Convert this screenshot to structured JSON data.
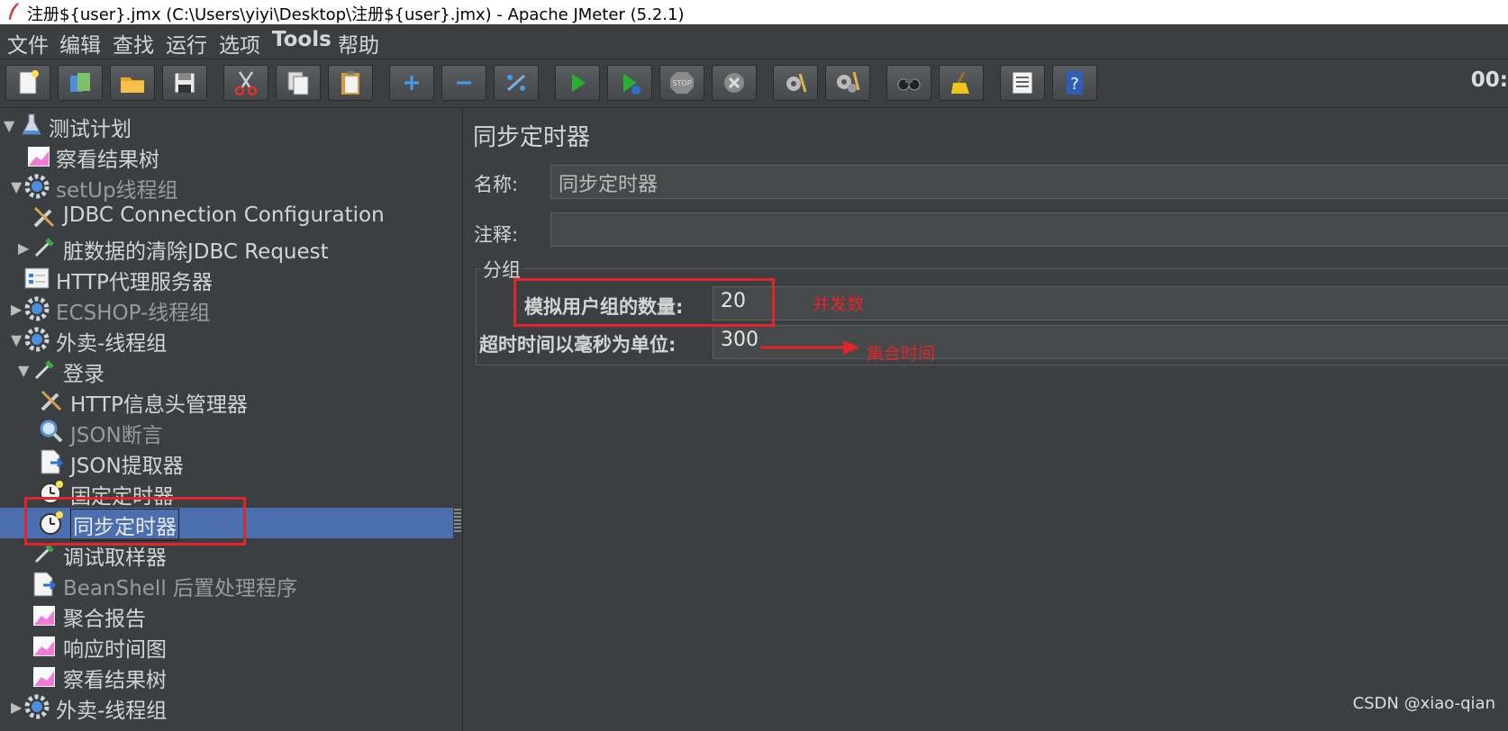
{
  "window": {
    "title": "注册${user}.jmx (C:\\Users\\yiyi\\Desktop\\注册${user}.jmx) - Apache JMeter (5.2.1)"
  },
  "menu": {
    "items": [
      "文件",
      "编辑",
      "查找",
      "运行",
      "选项",
      "Tools",
      "帮助"
    ]
  },
  "toolbar": {
    "buttons": [
      "new-icon",
      "templates-icon",
      "open-icon",
      "save-icon",
      "cut-icon",
      "copy-icon",
      "paste-icon",
      "expand-icon",
      "collapse-icon",
      "toggle-icon",
      "start-icon",
      "start-no-pause-icon",
      "stop-icon",
      "shutdown-icon",
      "clear-icon",
      "clear-all-icon",
      "search-icon",
      "reset-search-icon",
      "function-helper-icon",
      "help-icon"
    ],
    "timer": "00:"
  },
  "tree": {
    "items": [
      {
        "label": "测试计划",
        "icon": "flask-icon",
        "arrow": "▼"
      },
      {
        "label": "察看结果树",
        "icon": "graph-icon",
        "arrow": ""
      },
      {
        "label": "setUp线程组",
        "icon": "gear-icon",
        "arrow": "▼"
      },
      {
        "label": "JDBC Connection Configuration",
        "icon": "wrench-icon",
        "arrow": ""
      },
      {
        "label": "脏数据的清除JDBC Request",
        "icon": "dropper-icon",
        "arrow": "▶"
      },
      {
        "label": "HTTP代理服务器",
        "icon": "proxy-icon",
        "arrow": ""
      },
      {
        "label": "ECSHOP-线程组",
        "icon": "gear-icon",
        "arrow": "▶"
      },
      {
        "label": "外卖-线程组",
        "icon": "gear-icon",
        "arrow": "▼"
      },
      {
        "label": "登录",
        "icon": "dropper-icon",
        "arrow": "▼"
      },
      {
        "label": "HTTP信息头管理器",
        "icon": "wrench-icon",
        "arrow": ""
      },
      {
        "label": "JSON断言",
        "icon": "magnifier-icon",
        "arrow": ""
      },
      {
        "label": "JSON提取器",
        "icon": "document-icon",
        "arrow": ""
      },
      {
        "label": "固定定时器",
        "icon": "clock-icon",
        "arrow": ""
      },
      {
        "label": "同步定时器",
        "icon": "clock-icon",
        "arrow": ""
      },
      {
        "label": "调试取样器",
        "icon": "dropper-icon",
        "arrow": ""
      },
      {
        "label": "BeanShell 后置处理程序",
        "icon": "document-icon",
        "arrow": ""
      },
      {
        "label": "聚合报告",
        "icon": "graph-icon",
        "arrow": ""
      },
      {
        "label": "响应时间图",
        "icon": "graph-icon",
        "arrow": ""
      },
      {
        "label": "察看结果树",
        "icon": "graph-icon",
        "arrow": ""
      },
      {
        "label": "外卖-线程组",
        "icon": "gear-icon",
        "arrow": "▶"
      }
    ]
  },
  "panel": {
    "title": "同步定时器",
    "name_label": "名称:",
    "name_value": "同步定时器",
    "comment_label": "注释:",
    "comment_value": "",
    "group_label": "分组",
    "users_label": "模拟用户组的数量:",
    "users_value": "20",
    "timeout_label": "超时时间以毫秒为单位:",
    "timeout_value": "300"
  },
  "annotations": {
    "concurrency": "并发数",
    "gather_time": "集合时间",
    "color": "#e0262c"
  },
  "watermark": "CSDN @xiao-qian",
  "colors": {
    "background": "#3c3f41",
    "selection": "#4b6eaf"
  }
}
